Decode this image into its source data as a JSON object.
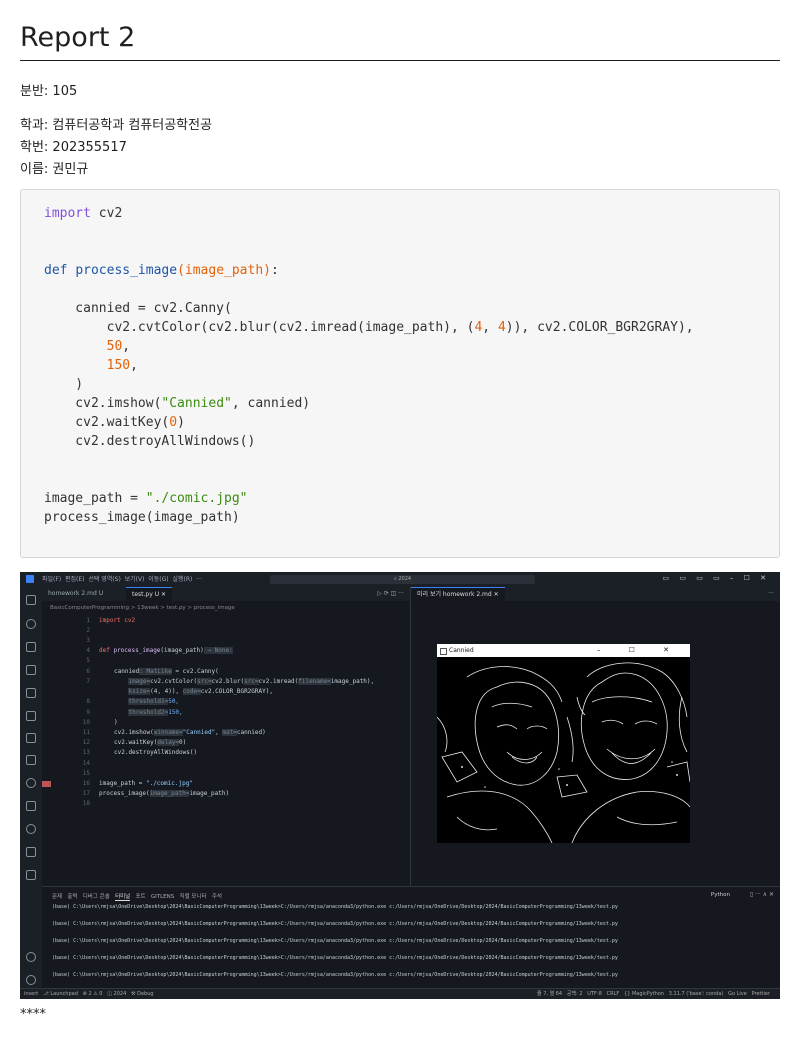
{
  "title": "Report 2",
  "meta": {
    "section": "분반: 105",
    "department": "학과: 컴퓨터공학과 컴퓨터공학전공",
    "student_id": "학번: 202355517",
    "name": "이름: 권민규"
  },
  "code": {
    "l1a": "import",
    "l1b": " cv2",
    "l2a": "def",
    "l2b": "process_image",
    "l2c": "(image_path)",
    "l2d": ":",
    "l3": "    cannied = cv2.Canny(",
    "l4a": "        cv2.cvtColor(cv2.blur(cv2.imread(image_path), (",
    "l4b": "4",
    "l4c": ", ",
    "l4d": "4",
    "l4e": ")), cv2.COLOR_BGR2GRAY),",
    "l5": "50",
    "l6": "150",
    "l7": "    )",
    "l8a": "    cv2.imshow(",
    "l8b": "\"Cannied\"",
    "l8c": ", cannied)",
    "l9a": "    cv2.waitKey(",
    "l9b": "0",
    "l9c": ")",
    "l10": "    cv2.destroyAllWindows()",
    "l11a": "image_path = ",
    "l11b": "\"./comic.jpg\"",
    "l12": "process_image(image_path)"
  },
  "screenshot": {
    "menu": "파일(F)  편집(E)  선택 영역(S)  보기(V)  이동(G)  실행(R)  ···",
    "search": "⌕ 2024",
    "tab1": "homework 2.md U",
    "tab2": "test.py   U  ✕",
    "tab3": "미리 보기 homework 2.md  ✕",
    "breadcrumb": "BasicComputerProgramming > 13week > test.py > process_image",
    "editor_lines": {
      "n1": "1",
      "n2": "2",
      "n3": "3",
      "n4": "4",
      "n5": "5",
      "n6": "6",
      "n7": "7",
      "n8": "8",
      "n9": "9",
      "n10": "10",
      "n11": "11",
      "n12": "12",
      "n13": "13",
      "n14": "14",
      "n15": "15",
      "n16": "16",
      "n17": "17",
      "n18": "18",
      "c1": "import cv2",
      "c4a": "def ",
      "c4b": "process_image",
      "c4c": "(image_path)",
      "c4d": " → None:",
      "c6a": "cannied",
      "c6b": ": MatLike",
      "c6c": " = cv2.Canny(",
      "c7a": "    ",
      "c7b": "image=",
      "c7c": "cv2.cvtColor(",
      "c7d": "src=",
      "c7e": "cv2.blur(",
      "c7f": "src=",
      "c7g": "cv2.imread(",
      "c7h": "filename=",
      "c7i": "image_path),",
      "c7j": "    ",
      "c7k": "ksize=",
      "c7l": "(4, 4)), ",
      "c7m": "code=",
      "c7n": "cv2.COLOR_BGR2GRAY),",
      "c8a": "    ",
      "c8b": "threshold1=",
      "c8c": "50,",
      "c9a": "    ",
      "c9b": "threshold2=",
      "c9c": "150,",
      "c10": ")",
      "c11a": "cv2.imshow(",
      "c11b": "winname=",
      "c11c": "\"Cannied\"",
      "c11d": ", ",
      "c11e": "mat=",
      "c11f": "cannied)",
      "c12a": "cv2.waitKey(",
      "c12b": "delay=",
      "c12c": "0)",
      "c13": "cv2.destroyAllWindows()",
      "c16a": "image_path = ",
      "c16b": "\"./comic.jpg\"",
      "c17a": "process_image(",
      "c17b": "image_path=",
      "c17c": "image_path)"
    },
    "window_title": "Cannied",
    "window_controls": "–  ☐  ✕",
    "panel_tabs": {
      "t1": "문제",
      "t2": "출력",
      "t3": "디버그 콘솔",
      "t4": "터미널",
      "t5": "포트",
      "t6": "GITLENS",
      "t7": "직렬 모니터",
      "t8": "주석"
    },
    "terminal_label": "Python",
    "terminal_line": "(base) C:\\Users\\rmjsa\\OneDrive\\Desktop\\2024\\BasicComputerProgramming\\13week>C:/Users/rmjsa/anaconda3/python.exe c:/Users/rmjsa/OneDrive/Desktop/2024/BasicComputerProgramming/13week/test.py",
    "status_left": "insert   ⎇ Launchpad   ⊗ 2 ⚠ 0   ◫ 2024   ⚒ Debug",
    "status_right": "줄 7, 열 64   공백: 2   UTF-8   CRLF   {} MagicPython   3.11.7 ('base': conda)   Go Live   Prettier"
  },
  "footer": "****",
  "colors": {
    "editor_bg": "#15181e",
    "accent": "#3b82f6"
  }
}
